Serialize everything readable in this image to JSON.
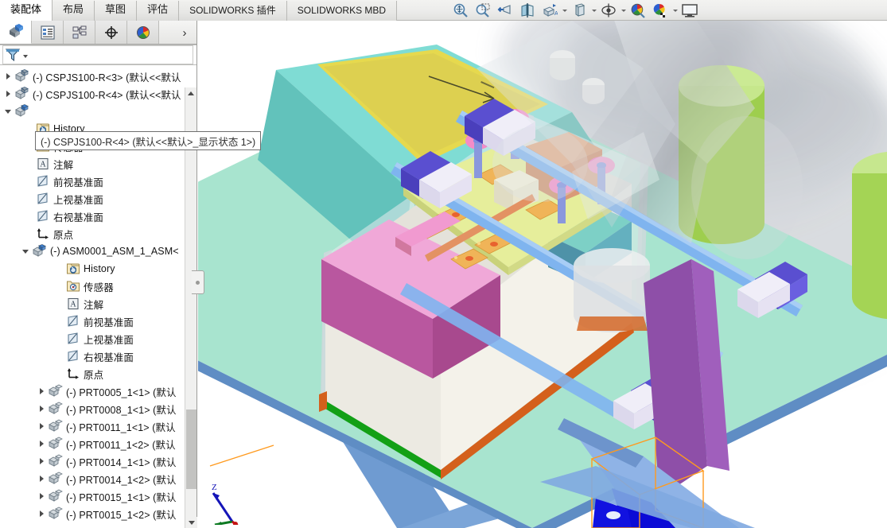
{
  "ribbon": {
    "tabs": [
      {
        "label": "装配体",
        "lang": "cn",
        "active": true
      },
      {
        "label": "布局",
        "lang": "cn",
        "active": false
      },
      {
        "label": "草图",
        "lang": "cn",
        "active": false
      },
      {
        "label": "评估",
        "lang": "cn",
        "active": false
      },
      {
        "label": "SOLIDWORKS 插件",
        "lang": "en",
        "active": false
      },
      {
        "label": "SOLIDWORKS MBD",
        "lang": "en",
        "active": false
      }
    ],
    "tools": [
      {
        "name": "zoom-to-fit-icon"
      },
      {
        "name": "zoom-to-area-icon"
      },
      {
        "name": "previous-view-icon"
      },
      {
        "name": "section-view-icon"
      },
      {
        "name": "view-orientation-icon"
      },
      {
        "name": "display-style-dropdown-caret"
      },
      {
        "name": "display-style-icon"
      },
      {
        "name": "display-style-caret"
      },
      {
        "name": "hide-show-items-icon"
      },
      {
        "name": "hide-show-caret"
      },
      {
        "name": "edit-appearance-icon"
      },
      {
        "name": "apply-scene-icon"
      },
      {
        "name": "apply-scene-caret"
      },
      {
        "name": "view-settings-icon"
      }
    ]
  },
  "manager": {
    "tabs": [
      {
        "name": "feature-manager-design-tree",
        "label": "FeatureManager 设计树",
        "active": true
      },
      {
        "name": "property-manager",
        "label": "PropertyManager",
        "active": false
      },
      {
        "name": "configuration-manager",
        "label": "ConfigurationManager",
        "active": false
      },
      {
        "name": "dimxpert-manager",
        "label": "DimXpertManager",
        "active": false
      },
      {
        "name": "display-manager",
        "label": "DisplayManager",
        "active": false
      }
    ],
    "expand_label": "›",
    "filter": {
      "placeholder": "",
      "value": "",
      "icon": "filter-funnel-icon"
    }
  },
  "tooltip": {
    "text": "(-) CSPJS100-R<4>  (默认<<默认>_显示状态 1>)"
  },
  "tree": [
    {
      "id": "n0",
      "label": "(-) CSPJS100-R<3>  (默认<<默认",
      "icon": "assembly-icon",
      "indent": "ind1",
      "arrow": "closed"
    },
    {
      "id": "n1",
      "label": "(-) CSPJS100-R<4>  (默认<<默认",
      "icon": "assembly-icon",
      "indent": "ind1",
      "arrow": "closed"
    },
    {
      "id": "n2",
      "label": "",
      "icon": "assembly-icon-selected",
      "indent": "ind1",
      "arrow": "open"
    },
    {
      "id": "n3",
      "label": "History",
      "icon": "history-icon",
      "indent": "ind3b",
      "arrow": "none"
    },
    {
      "id": "n4",
      "label": "传感器",
      "icon": "sensors-icon",
      "indent": "ind3b",
      "arrow": "none"
    },
    {
      "id": "n5",
      "label": "注解",
      "icon": "annotations-icon",
      "indent": "ind3b",
      "arrow": "none"
    },
    {
      "id": "n6",
      "label": "前视基准面",
      "icon": "plane-icon",
      "indent": "ind3b",
      "arrow": "none"
    },
    {
      "id": "n7",
      "label": "上视基准面",
      "icon": "plane-icon",
      "indent": "ind3b",
      "arrow": "none"
    },
    {
      "id": "n8",
      "label": "右视基准面",
      "icon": "plane-icon",
      "indent": "ind3b",
      "arrow": "none"
    },
    {
      "id": "n9",
      "label": "原点",
      "icon": "origin-icon",
      "indent": "ind3b",
      "arrow": "none"
    },
    {
      "id": "n10",
      "label": "(-) ASM0001_ASM_1_ASM<",
      "icon": "assembly-icon-selected",
      "indent": "ind2",
      "arrow": "open"
    },
    {
      "id": "n11",
      "label": "History",
      "icon": "history-icon",
      "indent": "ind4",
      "arrow": "none"
    },
    {
      "id": "n12",
      "label": "传感器",
      "icon": "sensors-icon",
      "indent": "ind4",
      "arrow": "none"
    },
    {
      "id": "n13",
      "label": "注解",
      "icon": "annotations-icon",
      "indent": "ind4",
      "arrow": "none"
    },
    {
      "id": "n14",
      "label": "前视基准面",
      "icon": "plane-icon",
      "indent": "ind4",
      "arrow": "none"
    },
    {
      "id": "n15",
      "label": "上视基准面",
      "icon": "plane-icon",
      "indent": "ind4",
      "arrow": "none"
    },
    {
      "id": "n16",
      "label": "右视基准面",
      "icon": "plane-icon",
      "indent": "ind4",
      "arrow": "none"
    },
    {
      "id": "n17",
      "label": "原点",
      "icon": "origin-icon",
      "indent": "ind4",
      "arrow": "none"
    },
    {
      "id": "n18",
      "label": "(-) PRT0005_1<1>  (默认",
      "icon": "part-icon",
      "indent": "ind3",
      "arrow": "closed"
    },
    {
      "id": "n19",
      "label": "(-) PRT0008_1<1>  (默认",
      "icon": "part-icon",
      "indent": "ind3",
      "arrow": "closed"
    },
    {
      "id": "n20",
      "label": "(-) PRT0011_1<1>  (默认",
      "icon": "part-icon",
      "indent": "ind3",
      "arrow": "closed"
    },
    {
      "id": "n21",
      "label": "(-) PRT0011_1<2>  (默认",
      "icon": "part-icon",
      "indent": "ind3",
      "arrow": "closed"
    },
    {
      "id": "n22",
      "label": "(-) PRT0014_1<1>  (默认",
      "icon": "part-icon",
      "indent": "ind3",
      "arrow": "closed"
    },
    {
      "id": "n23",
      "label": "(-) PRT0014_1<2>  (默认",
      "icon": "part-icon",
      "indent": "ind3",
      "arrow": "closed"
    },
    {
      "id": "n24",
      "label": "(-) PRT0015_1<1>  (默认",
      "icon": "part-icon",
      "indent": "ind3",
      "arrow": "closed"
    },
    {
      "id": "n25",
      "label": "(-) PRT0015_1<2>  (默认",
      "icon": "part-icon",
      "indent": "ind3",
      "arrow": "closed"
    }
  ],
  "viewport": {
    "triad": {
      "z_label": "Z",
      "x_label": "",
      "y_label": ""
    },
    "colors": {
      "table_top": "#a8e4cf",
      "table_frame": "#6f9bd1",
      "enclosure_glass": "#d8dfe2",
      "cyan_block": "#7fdcd4",
      "yellow_plate": "#e9e08a",
      "magenta_panel": "#b9579f",
      "pink_panel": "#f0a8d8",
      "green_edge": "#13a016",
      "orange_edge": "#d4601c",
      "blue_rod": "#7fb4ef",
      "purple_collar": "#5a4fd0",
      "plate_yellow": "#e6ee9b",
      "tan_block": "#d99a78",
      "green_cylinder": "#aadb60",
      "purple_column": "#8e4fa8",
      "selection_box": "#ff9a1e",
      "selected_part": "#0b0bd6"
    }
  }
}
